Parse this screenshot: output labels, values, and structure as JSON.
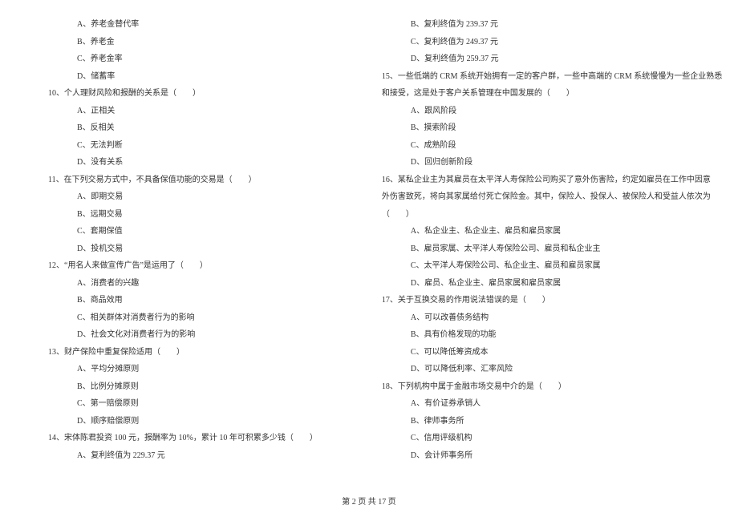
{
  "left": {
    "q9opts": [
      "A、养老金替代率",
      "B、养老金",
      "C、养老金率",
      "D、储蓄率"
    ],
    "q10": "10、个人理财风险和报酬的关系是（　　）",
    "q10opts": [
      "A、正相关",
      "B、反相关",
      "C、无法判断",
      "D、没有关系"
    ],
    "q11": "11、在下列交易方式中，不具备保值功能的交易是（　　）",
    "q11opts": [
      "A、即期交易",
      "B、远期交易",
      "C、套期保值",
      "D、投机交易"
    ],
    "q12": "12、“用名人来做宣传广告”是运用了（　　）",
    "q12opts": [
      "A、消费者的兴趣",
      "B、商品效用",
      "C、相关群体对消费者行为的影响",
      "D、社会文化对消费者行为的影响"
    ],
    "q13": "13、财产保险中重复保险适用（　　）",
    "q13opts": [
      "A、平均分摊原则",
      "B、比例分摊原则",
      "C、第一赔偿原则",
      "D、顺序赔偿原则"
    ],
    "q14": "14、宋体陈君投资 100 元，报酬率为 10%，累计 10 年可积累多少钱（　　）",
    "q14opts": [
      "A、复利终值为 229.37 元"
    ]
  },
  "right": {
    "q14opts_cont": [
      "B、复利终值为 239.37 元",
      "C、复利终值为 249.37 元",
      "D、复利终值为 259.37 元"
    ],
    "q15a": "15、一些低端的 CRM 系统开始拥有一定的客户群，一些中高端的 CRM 系统慢慢为一些企业熟悉",
    "q15b": "和接受，这是处于客户关系管理在中国发展的（　　）",
    "q15opts": [
      "A、跟风阶段",
      "B、摸索阶段",
      "C、成熟阶段",
      "D、回归创新阶段"
    ],
    "q16a": "16、某私企业主为其雇员在太平洋人寿保险公司购买了意外伤害险，约定如雇员在工作中因意",
    "q16b": "外伤害致死，将向其家属给付死亡保险金。其中，保险人、投保人、被保险人和受益人依次为",
    "q16c": "（　　）",
    "q16opts": [
      "A、私企业主、私企业主、雇员和雇员家属",
      "B、雇员家属、太平洋人寿保险公司、雇员和私企业主",
      "C、太平洋人寿保险公司、私企业主、雇员和雇员家属",
      "D、雇员、私企业主、雇员家属和雇员家属"
    ],
    "q17": "17、关于互换交易的作用说法错误的是（　　）",
    "q17opts": [
      "A、可以改善债务结构",
      "B、具有价格发现的功能",
      "C、可以降低筹资成本",
      "D、可以降低利率、汇率风险"
    ],
    "q18": "18、下列机构中属于金融市场交易中介的是（　　）",
    "q18opts": [
      "A、有价证券承销人",
      "B、律师事务所",
      "C、信用评级机构",
      "D、会计师事务所"
    ]
  },
  "footer": "第 2 页 共 17 页"
}
